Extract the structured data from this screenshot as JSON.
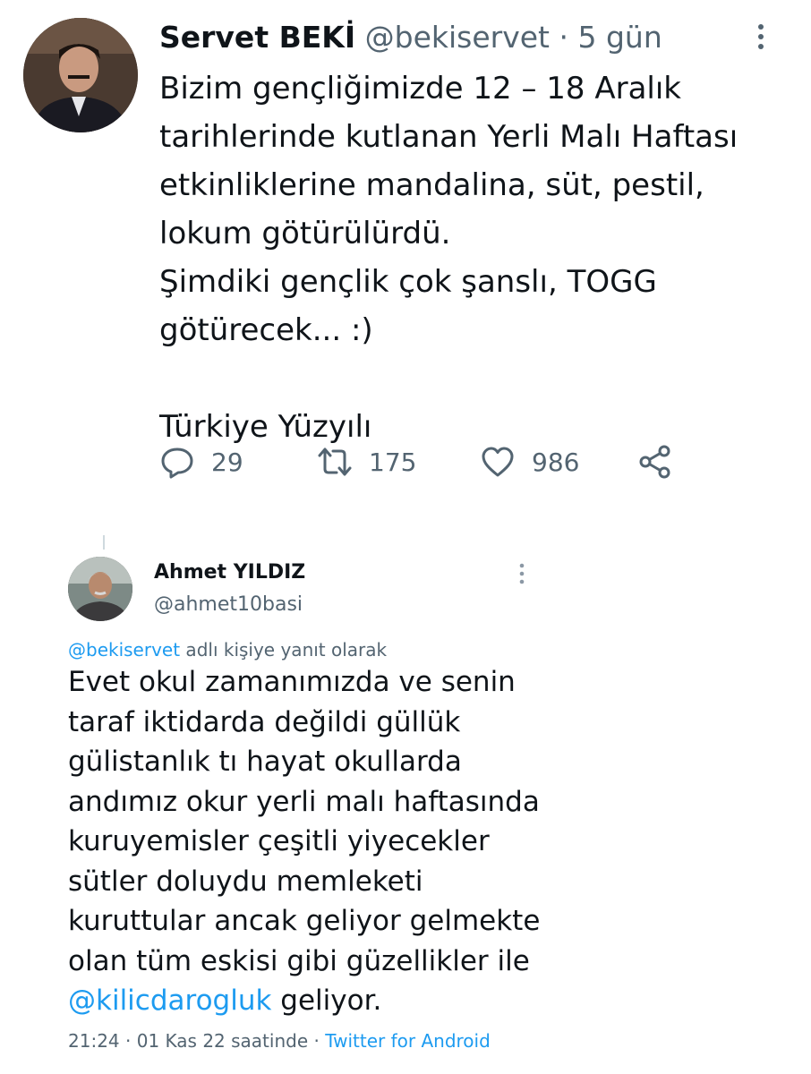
{
  "tweet1": {
    "author_name": "Servet BEKİ",
    "handle": "@bekiservet",
    "separator": "·",
    "time": "5 gün",
    "body": "Bizim gençliğimizde 12 – 18 Aralık\ntarihlerinde kutlanan Yerli Malı Haftası\netkinliklerine mandalina, süt, pestil,\nlokum götürülürdü.\nŞimdiki gençlik çok şanslı, TOGG\ngötürecek... :)\n\nTürkiye Yüzyılı",
    "actions": {
      "replies": "29",
      "retweets": "175",
      "likes": "986"
    },
    "icons": {
      "reply": "reply-icon",
      "retweet": "retweet-icon",
      "like": "heart-icon",
      "share": "share-icon",
      "more": "more-options-icon"
    }
  },
  "tweet2": {
    "author_name": "Ahmet YILDIZ",
    "handle": "@ahmet10basi",
    "reply_to_handle": "@bekiservet",
    "reply_to_suffix": " adlı kişiye yanıt olarak",
    "body_text": "Evet okul zamanımızda ve senin\ntaraf iktidarda değildi güllük\ngülistanlık tı hayat okullarda\nandımız okur yerli malı haftasında\nkuruyemisler çeşitli yiyecekler\nsütler doluydu memleketi\nkuruttular ancak geliyor gelmekte\nolan tüm eskisi gibi güzellikler ile",
    "mention": "@kilicdarogluk",
    "body_end": " geliyor.",
    "time": "21:24",
    "date": "01 Kas 22 saatinde",
    "separator": "·",
    "source": "Twitter for Android"
  },
  "colors": {
    "link": "#1d9bf0",
    "muted": "#536471",
    "text": "#0f1419"
  }
}
